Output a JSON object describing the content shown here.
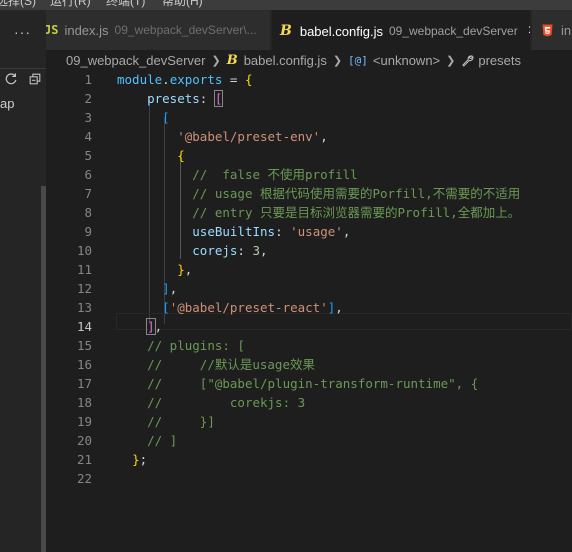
{
  "menu": {
    "items": [
      "选择(S)",
      "运行(R)",
      "终端(T)",
      "帮助(H)"
    ]
  },
  "sidebar": {
    "more": "···",
    "label": "ap"
  },
  "tabs": [
    {
      "filename": "index.js",
      "path": "09_webpack_devServer\\...",
      "icon": "js-icon"
    },
    {
      "filename": "babel.config.js",
      "path": "09_webpack_devServer",
      "icon": "babel-icon",
      "active": true,
      "close": "×"
    },
    {
      "filename": "in",
      "path": "",
      "icon": "html5-icon"
    }
  ],
  "breadcrumb": {
    "folder": "09_webpack_devServer",
    "file": "babel.config.js",
    "symbol": "<unknown>",
    "property": "presets"
  },
  "editor": {
    "active_line": 14,
    "lines": [
      {
        "n": "1"
      },
      {
        "n": "2"
      },
      {
        "n": "3"
      },
      {
        "n": "4"
      },
      {
        "n": "5"
      },
      {
        "n": "6"
      },
      {
        "n": "7"
      },
      {
        "n": "8"
      },
      {
        "n": "9"
      },
      {
        "n": "10"
      },
      {
        "n": "11"
      },
      {
        "n": "12"
      },
      {
        "n": "13"
      },
      {
        "n": "14"
      },
      {
        "n": "15"
      },
      {
        "n": "16"
      },
      {
        "n": "17"
      },
      {
        "n": "18"
      },
      {
        "n": "19"
      },
      {
        "n": "20"
      },
      {
        "n": "21"
      },
      {
        "n": "22"
      }
    ],
    "tokens": {
      "l1": {
        "module": "module",
        "dot": ".",
        "exports": "exports",
        "eq": " = ",
        "brace": "{"
      },
      "l2": {
        "presets": "presets",
        "colon": ": ",
        "bracket": "["
      },
      "l3": {
        "bracket": "["
      },
      "l4": {
        "str": "'@babel/preset-env'",
        "comma": ","
      },
      "l5": {
        "brace": "{"
      },
      "l6": {
        "comment": "//  false 不使用profill"
      },
      "l7": {
        "comment": "// usage 根据代码使用需要的Porfill,不需要的不适用"
      },
      "l8": {
        "comment": "// entry 只要是目标浏览器需要的Profill,全都加上。"
      },
      "l9": {
        "key": "useBuiltIns",
        "colon": ": ",
        "str": "'usage'",
        "comma": ","
      },
      "l10": {
        "key": "corejs",
        "colon": ": ",
        "num": "3",
        "comma": ","
      },
      "l11": {
        "brace": "}",
        "comma": ","
      },
      "l12": {
        "bracket": "]",
        "comma": ","
      },
      "l13": {
        "open": "[",
        "str": "'@babel/preset-react'",
        "close": "]",
        "comma": ","
      },
      "l14": {
        "bracket": "]",
        "comma": ","
      },
      "l15": {
        "comment": "// plugins: ["
      },
      "l16": {
        "comment": "//     //默认是usage效果"
      },
      "l17": {
        "comment": "//     [\"@babel/plugin-transform-runtime\", {"
      },
      "l18": {
        "comment": "//         corekjs: 3"
      },
      "l19": {
        "comment": "//     }]"
      },
      "l20": {
        "comment": "// ]"
      },
      "l21": {
        "brace": "}",
        "semi": ";"
      }
    }
  },
  "colors": {
    "background": "#1e1e1e",
    "keyword": "#569cd6",
    "string": "#ce9178",
    "comment": "#6a9955",
    "number": "#b5cea8"
  }
}
